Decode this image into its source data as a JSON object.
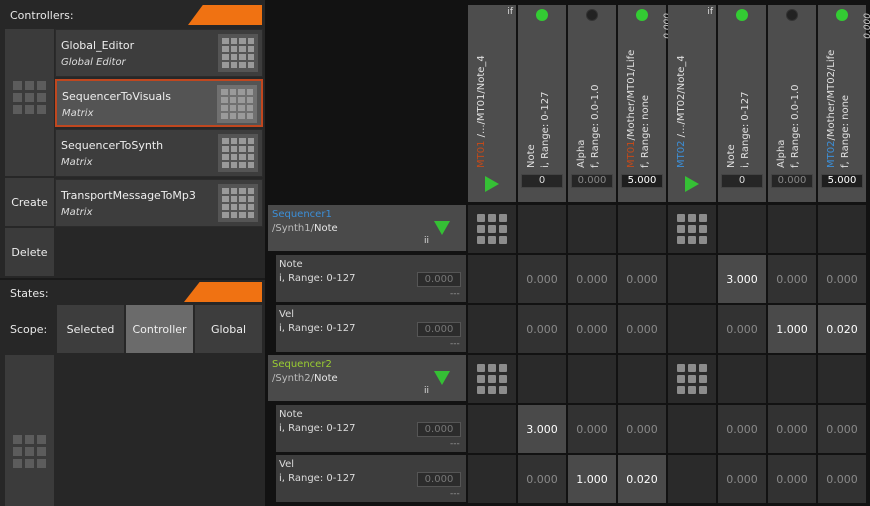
{
  "controllers_panel": {
    "title": "Controllers:"
  },
  "controllers": [
    {
      "name": "Global_Editor",
      "type": "Global Editor",
      "selected": false
    },
    {
      "name": "SequencerToVisuals",
      "type": "Matrix",
      "selected": true
    },
    {
      "name": "SequencerToSynth",
      "type": "Matrix",
      "selected": false
    },
    {
      "name": "TransportMessageToMp3",
      "type": "Matrix",
      "selected": false
    }
  ],
  "actions": {
    "create": "Create",
    "delete": "Delete"
  },
  "states_panel": {
    "title": "States:",
    "scope_label": "Scope:"
  },
  "scope_options": [
    "Selected",
    "Controller",
    "Global"
  ],
  "scope_selected": "Controller",
  "columns": [
    {
      "kind": "group",
      "prefix": "MT01",
      "path": "/.../MT01/Note_4",
      "badge": "if"
    },
    {
      "kind": "param",
      "name": "Note",
      "range": "i, Range: 0-127",
      "value": "0",
      "active": true
    },
    {
      "kind": "param",
      "name": "Alpha",
      "range": "f, Range: 0.0-1.0",
      "value": "0.000",
      "active": false
    },
    {
      "kind": "param",
      "prefix": "MT01",
      "name": "/Mother/MT01/Life",
      "range": "f, Range: none",
      "value": "5.000",
      "active": true,
      "top_value": "0.000"
    },
    {
      "kind": "group",
      "prefix": "MT02",
      "path": "/.../MT02/Note_4",
      "badge": "if"
    },
    {
      "kind": "param",
      "name": "Note",
      "range": "i, Range: 0-127",
      "value": "0",
      "active": true
    },
    {
      "kind": "param",
      "name": "Alpha",
      "range": "f, Range: 0.0-1.0",
      "value": "0.000",
      "active": false
    },
    {
      "kind": "param",
      "prefix": "MT02",
      "name": "/Mother/MT02/Life",
      "range": "f, Range: none",
      "value": "5.000",
      "active": true,
      "top_value": "0.000"
    }
  ],
  "rows": [
    {
      "kind": "seq",
      "name": "Sequencer1",
      "color": "#3c8fd8",
      "path_prefix": "/Synth1/",
      "path_leaf": "Note",
      "badge": "ii"
    },
    {
      "kind": "param",
      "name": "Note",
      "range": "i, Range: 0-127",
      "value": "0.000",
      "dashes": "---",
      "cells": [
        "",
        "0.000",
        "0.000",
        "0.000",
        "",
        "3.000",
        "0.000",
        "0.000"
      ],
      "active": [
        false,
        false,
        false,
        false,
        false,
        true,
        false,
        false
      ]
    },
    {
      "kind": "param",
      "name": "Vel",
      "range": "i, Range: 0-127",
      "value": "0.000",
      "dashes": "---",
      "cells": [
        "",
        "0.000",
        "0.000",
        "0.000",
        "",
        "0.000",
        "1.000",
        "0.020"
      ],
      "active": [
        false,
        false,
        false,
        false,
        false,
        false,
        true,
        true
      ]
    },
    {
      "kind": "seq",
      "name": "Sequencer2",
      "color": "#9acd32",
      "path_prefix": "/Synth2/",
      "path_leaf": "Note",
      "badge": "ii"
    },
    {
      "kind": "param",
      "name": "Note",
      "range": "i, Range: 0-127",
      "value": "0.000",
      "dashes": "---",
      "cells": [
        "",
        "3.000",
        "0.000",
        "0.000",
        "",
        "0.000",
        "0.000",
        "0.000"
      ],
      "active": [
        false,
        true,
        false,
        false,
        false,
        false,
        false,
        false
      ]
    },
    {
      "kind": "param",
      "name": "Vel",
      "range": "i, Range: 0-127",
      "value": "0.000",
      "dashes": "---",
      "cells": [
        "",
        "0.000",
        "1.000",
        "0.020",
        "",
        "0.000",
        "0.000",
        "0.000"
      ],
      "active": [
        false,
        false,
        true,
        true,
        false,
        false,
        false,
        false
      ]
    }
  ],
  "colors": {
    "accent": "#f07212",
    "selected_border": "#c0471f",
    "active_dot": "#33cc33",
    "play": "#35c035"
  }
}
